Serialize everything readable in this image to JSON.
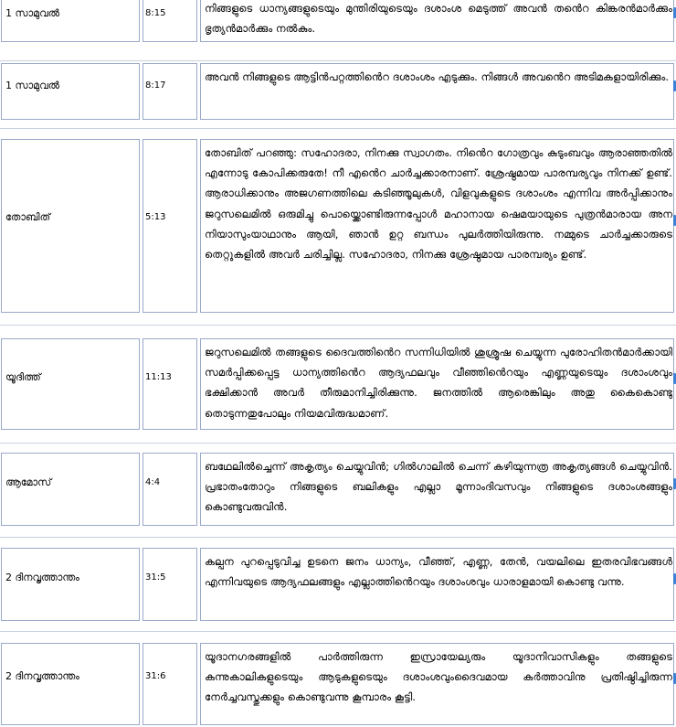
{
  "rows": [
    {
      "book": "1 സാമുവൽ",
      "ref": "8:15",
      "text": "നിങ്ങളുടെ ധാന്യങ്ങളുടെയും മുന്തിരിയുടെയും ദശാംശ മെടുത്ത് അവൻ തൻെറ കിങ്കരൻമാർക്കും ഭൃത്യൻമാർക്കും നൽകും."
    },
    {
      "book": "1 സാമുവൽ",
      "ref": "8:17",
      "text": "അവൻ നിങ്ങളുടെ ആട്ടിൻപറ്റത്തിൻെറ ദശാംശം എടുക്കും. നിങ്ങൾ അവൻെറ അടിമകളായിരിക്കും."
    },
    {
      "book": "തോബിത്",
      "ref": "5:13",
      "text": "തോബിത് പറഞ്ഞു: സഹോദരാ, നിനക്കു സ്വാഗതം. നിൻെറ ഗോത്രവും കുടുംബവും ആരാഞ്ഞതിൽ എന്നോടു കോപിക്കരുതേ! നീ എൻെറ ചാർച്ചക്കാരനാണ്. ശ്രേഷ്ഠമായ പാരമ്പര്യവും നിനക്ക് ഉണ്ട്. ആരാധിക്കാനും അജഗണത്തിലെ കടിഞ്ഞൂലുകൾ, വിളവുകളുടെ ദശാംശം എന്നിവ അർപ്പിക്കാനും ജറുസലെമിൽ ഒരുമിച്ചു പൊയ്ക്കൊണ്ടിരുന്നപ്പോൾ മഹാനായ ഷെമയായുടെ പുത്രൻമാരായ അന നിയാസുംയാഥാനും ആയി, ഞാൻ ഉറ്റ ബന്ധം പുലർത്തിയിരുന്നു. നമ്മുടെ ചാർച്ചക്കാരുടെ തെറ്റുകളിൽ അവർ ചരിച്ചില്ല. സഹോദരാ, നിനക്കു ശ്രേഷ്ഠമായ പാരമ്പര്യം ഉണ്ട്."
    },
    {
      "book": "യൂദിത്ത്",
      "ref": "11:13",
      "text": "ജറുസലെമിൽ തങ്ങളുടെ ദൈവത്തിൻെറ സന്നിധിയിൽ ശുശ്രൂഷ ചെയ്യുന്ന പുരോഹിതൻമാർക്കായി സമർപ്പിക്കപ്പെട്ട ധാന്യത്തിൻെറ ആദ്യഫലവും വീഞ്ഞിൻെറയും എണ്ണയുടെയും ദശാംശവും ഭക്ഷിക്കാൻ അവർ തീരുമാനിച്ചിരിക്കുന്നു. ജനത്തിൽ ആരെങ്കിലും അതു കൈകൊണ്ടു തൊടുന്നതുപോലും നിയമവിരുദ്ധമാണ്."
    },
    {
      "book": "ആമോസ്",
      "ref": "4:4",
      "text": "ബഥേലിൽച്ചെന്ന് അകൃത്യം ചെയ്യുവിൻ; ഗിൽഗാലിൽ ചെന്ന് കഴിയുന്നത്ര അകൃത്യങ്ങൾ ചെയ്യുവിൻ. പ്രഭാതംതോറും നിങ്ങളുടെ ബലികളും എല്ലാ മൂന്നാംദിവസവും നിങ്ങളുടെ ദശാംശങ്ങളും കൊണ്ടുവരുവിൻ."
    },
    {
      "book": "2 ദിനവൃത്താന്തം",
      "ref": "31:5",
      "text": "കല്പന പുറപ്പെടുവിച്ച ഉടനെ ജനം ധാന്യം, വീഞ്ഞ്, എണ്ണ, തേൻ, വയലിലെ ഇതരവിഭവങ്ങൾ എന്നിവയുടെ ആദ്യഫലങ്ങളും എല്ലാത്തിൻെറയും ദശാംശവും ധാരാളമായി കൊണ്ടു വന്നു."
    },
    {
      "book": "2 ദിനവൃത്താന്തം",
      "ref": "31:6",
      "text": "യൂദാനഗരങ്ങളിൽ പാർത്തിരുന്ന ഇസ്രായേല്യരും യൂദാനിവാസികളും തങ്ങളുടെ കന്നുകാലികളുടെയും ആടുകളുടെയും ദശാംശവുംദൈവമായ കർത്താവിനു പ്രതിഷ്ഠിച്ചിരുന്ന നേർച്ചവസ്തുക്കളും കൊണ്ടുവന്നു കൂമ്പാരം കൂട്ടി."
    }
  ]
}
